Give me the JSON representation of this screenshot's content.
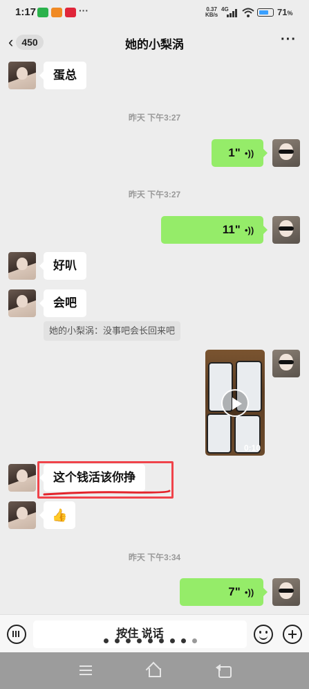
{
  "status_bar": {
    "time": "1:17",
    "more": "···",
    "speed_value": "0.37",
    "speed_unit": "KB/s",
    "network": "4G",
    "battery_percent": "71",
    "battery_unit": "%",
    "battery_level": 0.71
  },
  "header": {
    "back_icon": "chevron-left-icon",
    "unread_count": "450",
    "title": "她的小梨涡",
    "more_label": "···"
  },
  "messages": {
    "m1_text": "蛋总",
    "ts1": "昨天 下午3:27",
    "m2_voice_duration": "1\"",
    "ts2": "昨天 下午3:27",
    "m3_voice_duration": "11\"",
    "m4_text": "好叭",
    "m5_text": "会吧",
    "quote_text": "她的小梨涡：没事吧会长回来吧",
    "video_duration": "0:10",
    "m7_text": "这个钱活该你挣",
    "m8_emoji": "👍",
    "ts3": "昨天 下午3:34",
    "m9_voice_duration": "7\""
  },
  "voice_wave": "((•",
  "input_bar": {
    "hold_to_talk": "按住 说话",
    "page_count": 9,
    "active_page": 8
  },
  "colors": {
    "background": "#ededed",
    "sent_bubble": "#95ec69",
    "received_bubble": "#ffffff",
    "highlight": "#f0434a"
  },
  "icons": [
    "keyboard-icon",
    "emoji-icon",
    "plus-icon",
    "menu-icon",
    "home-icon",
    "back-icon",
    "wifi-icon",
    "signal-icon",
    "battery-icon"
  ]
}
